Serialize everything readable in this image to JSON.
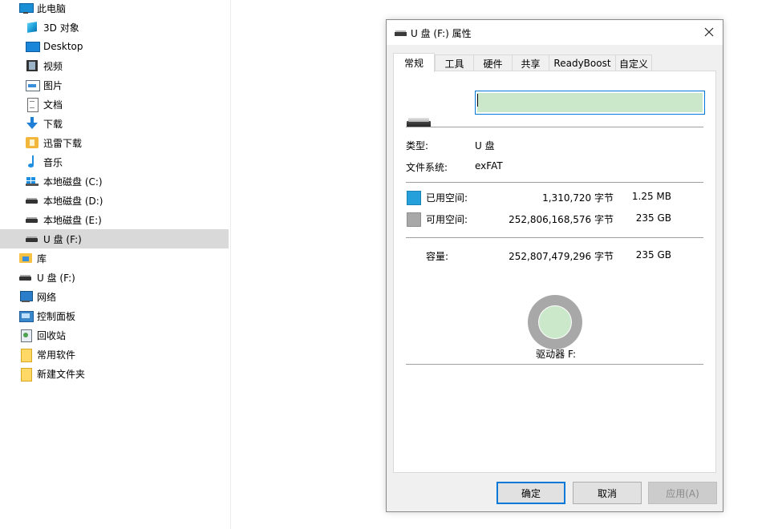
{
  "nav": {
    "items": [
      {
        "label": "此电脑",
        "icon": "computer-icon"
      },
      {
        "label": "3D 对象",
        "icon": "3d-objects-icon"
      },
      {
        "label": "Desktop",
        "icon": "desktop-icon"
      },
      {
        "label": "视频",
        "icon": "video-icon"
      },
      {
        "label": "图片",
        "icon": "picture-icon"
      },
      {
        "label": "文档",
        "icon": "document-icon"
      },
      {
        "label": "下载",
        "icon": "download-icon"
      },
      {
        "label": "迅雷下载",
        "icon": "thunder-download-icon"
      },
      {
        "label": "音乐",
        "icon": "music-icon"
      },
      {
        "label": "本地磁盘 (C:)",
        "icon": "system-drive-icon"
      },
      {
        "label": "本地磁盘 (D:)",
        "icon": "drive-icon"
      },
      {
        "label": "本地磁盘 (E:)",
        "icon": "drive-icon"
      },
      {
        "label": "U 盘 (F:)",
        "icon": "usb-drive-icon"
      },
      {
        "label": "库",
        "icon": "library-icon"
      },
      {
        "label": "U 盘 (F:)",
        "icon": "usb-drive-icon"
      },
      {
        "label": "网络",
        "icon": "network-icon"
      },
      {
        "label": "控制面板",
        "icon": "control-panel-icon"
      },
      {
        "label": "回收站",
        "icon": "recycle-bin-icon"
      },
      {
        "label": "常用软件",
        "icon": "folder-icon"
      },
      {
        "label": "新建文件夹",
        "icon": "folder-icon"
      }
    ],
    "selected_index": 12
  },
  "dialog": {
    "title": "U 盘 (F:) 属性",
    "close_glyph": "✕",
    "tabs": [
      "常规",
      "工具",
      "硬件",
      "共享",
      "ReadyBoost",
      "自定义"
    ],
    "active_tab": 0,
    "name_value": "",
    "type_label": "类型:",
    "type_value": "U 盘",
    "fs_label": "文件系统:",
    "fs_value": "exFAT",
    "used_label": "已用空间:",
    "used_bytes": "1,310,720 字节",
    "used_human": "1.25 MB",
    "free_label": "可用空间:",
    "free_bytes": "252,806,168,576 字节",
    "free_human": "235 GB",
    "capacity_label": "容量:",
    "capacity_bytes": "252,807,479,296 字节",
    "capacity_human": "235 GB",
    "drive_label": "驱动器 F:",
    "used_fraction": 5e-06,
    "colors": {
      "used": "#26a0da",
      "free": "#a8a8a8",
      "selection": "#cbe8cb"
    },
    "buttons": {
      "ok": "确定",
      "cancel": "取消",
      "apply": "应用(A)"
    }
  }
}
